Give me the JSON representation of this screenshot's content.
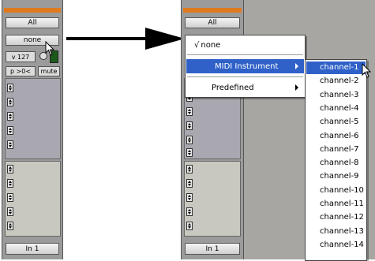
{
  "left_strip": {
    "group_label": "All",
    "instrument_select": "none",
    "velocity": "v 127",
    "pan": "p >0<",
    "mute_label": "mute",
    "track_label": "In 1"
  },
  "right_strip": {
    "group_label": "All",
    "track_label": "In 1"
  },
  "menu": {
    "checked_item": "none",
    "check_mark": "√",
    "items": [
      {
        "label": "MIDI Instrument",
        "has_submenu": true,
        "highlighted": true
      },
      {
        "label": "Predefined",
        "has_submenu": true,
        "highlighted": false
      }
    ]
  },
  "submenu": {
    "channels": [
      "channel-1",
      "channel-2",
      "channel-3",
      "channel-4",
      "channel-5",
      "channel-6",
      "channel-7",
      "channel-8",
      "channel-9",
      "channel-10",
      "channel-11",
      "channel-12",
      "channel-13",
      "channel-14"
    ],
    "highlighted": "channel-1"
  },
  "colors": {
    "highlight": "#2f61c8",
    "header_orange": "#e07a1f",
    "strip_gray": "#9b9b9b"
  }
}
